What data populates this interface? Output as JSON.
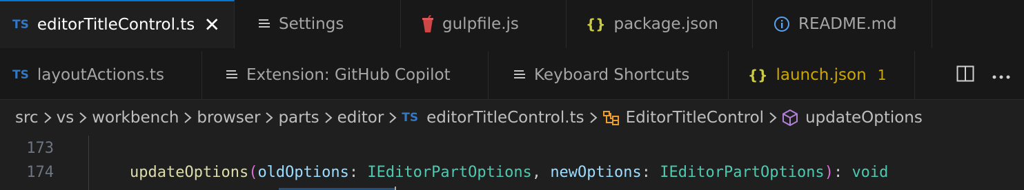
{
  "tabs_row1": [
    {
      "icon": "ts",
      "label": "editorTitleControl.ts",
      "active": true,
      "close": "✕"
    },
    {
      "icon": "settings",
      "label": "Settings"
    },
    {
      "icon": "gulp",
      "label": "gulpfile.js"
    },
    {
      "icon": "json",
      "label": "package.json"
    },
    {
      "icon": "info",
      "label": "README.md"
    }
  ],
  "tabs_row2": [
    {
      "icon": "ts",
      "label": "layoutActions.ts"
    },
    {
      "icon": "lines",
      "label": "Extension: GitHub Copilot"
    },
    {
      "icon": "lines",
      "label": "Keyboard Shortcuts"
    },
    {
      "icon": "json",
      "label": "launch.json",
      "problems": "1"
    }
  ],
  "icons": {
    "ts": "TS",
    "json": "{}",
    "info": "i"
  },
  "breadcrumbs": {
    "parts": [
      "src",
      "vs",
      "workbench",
      "browser",
      "parts",
      "editor"
    ],
    "file": "editorTitleControl.ts",
    "class": "EditorTitleControl",
    "method": "updateOptions"
  },
  "editor": {
    "lines": [
      {
        "number": "173"
      },
      {
        "number": "174",
        "fn": "updateOptions",
        "open_paren": "(",
        "param1": "oldOptions",
        "colon1": ": ",
        "type1": "IEditorPartOptions",
        "comma": ", ",
        "param2": "newOptions",
        "colon2": ": ",
        "type2": "IEditorPartOptions",
        "close_paren": ")",
        "ret_colon": ": ",
        "ret_type": "void"
      }
    ]
  },
  "colors": {
    "accent": "#0078d4",
    "ts_blue": "#3178c6",
    "json_yellow": "#cbcb41",
    "modified": "#cca700",
    "gulp_red": "#cf4647",
    "symbol_class": "#ee9d28",
    "symbol_method": "#b180d7"
  }
}
